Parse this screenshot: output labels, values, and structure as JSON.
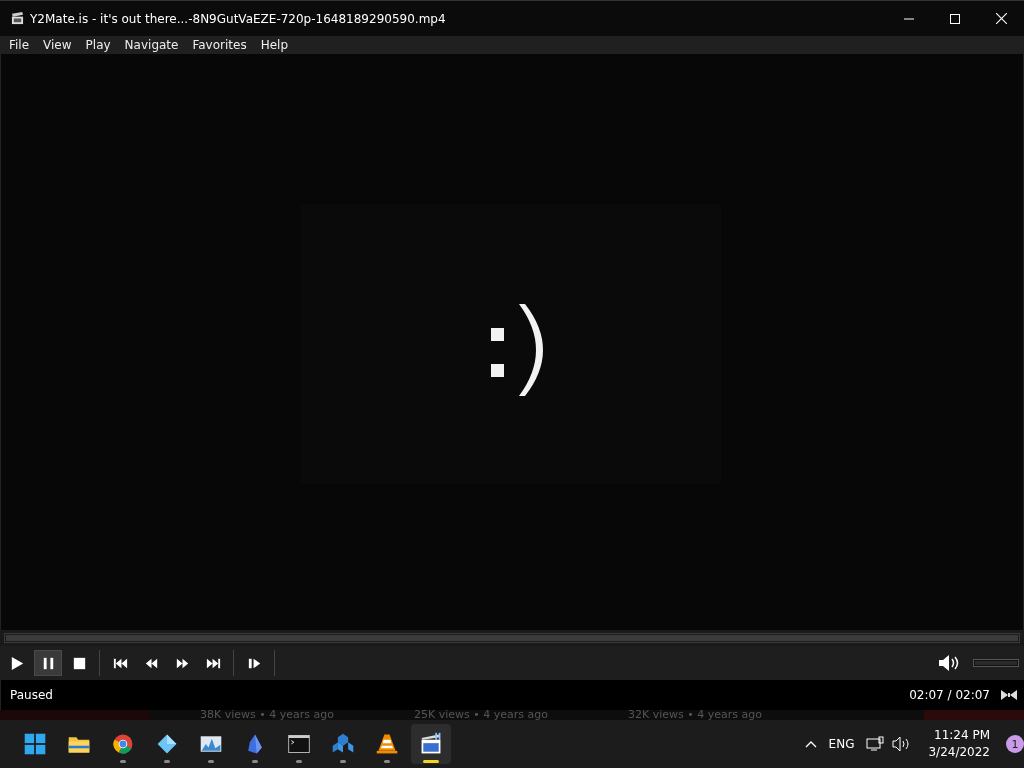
{
  "window": {
    "title": "Y2Mate.is - it's out there...-8N9GutVaEZE-720p-1648189290590.mp4"
  },
  "menu": [
    "File",
    "View",
    "Play",
    "Navigate",
    "Favorites",
    "Help"
  ],
  "seek_bar": {
    "level": 1
  },
  "controls": [
    {
      "kind": "play",
      "selected": false
    },
    {
      "kind": "pause",
      "selected": true
    },
    {
      "kind": "stop",
      "selected": false
    },
    {
      "kind": "previous",
      "selected": false
    },
    {
      "kind": "rewind",
      "selected": false
    },
    {
      "kind": "fast-forward",
      "selected": false
    },
    {
      "kind": "next",
      "selected": false
    },
    {
      "kind": "frame-step",
      "selected": false
    }
  ],
  "volume": {
    "level": 1
  },
  "status_bar": {
    "state": "Paused",
    "time": "02:07 / 02:07"
  },
  "background_window": [
    "38K views • 4 years ago",
    "25K views • 4 years ago",
    "32K views • 4 years ago"
  ],
  "taskbar": {
    "apps": [
      {
        "kind": "start",
        "running": false,
        "selected": false
      },
      {
        "kind": "folder",
        "running": false,
        "selected": false
      },
      {
        "kind": "browser",
        "running": true,
        "selected": false
      },
      {
        "kind": "diamond",
        "running": true,
        "selected": false
      },
      {
        "kind": "chart",
        "running": true,
        "selected": false
      },
      {
        "kind": "crystal",
        "running": true,
        "selected": false
      },
      {
        "kind": "terminal",
        "running": true,
        "selected": false
      },
      {
        "kind": "cube",
        "running": true,
        "selected": false
      },
      {
        "kind": "cone",
        "running": true,
        "selected": false
      },
      {
        "kind": "player",
        "running": true,
        "selected": true
      }
    ],
    "language": "ENG",
    "time": "11:24 PM",
    "date": "3/24/2022",
    "notifications": "1"
  }
}
